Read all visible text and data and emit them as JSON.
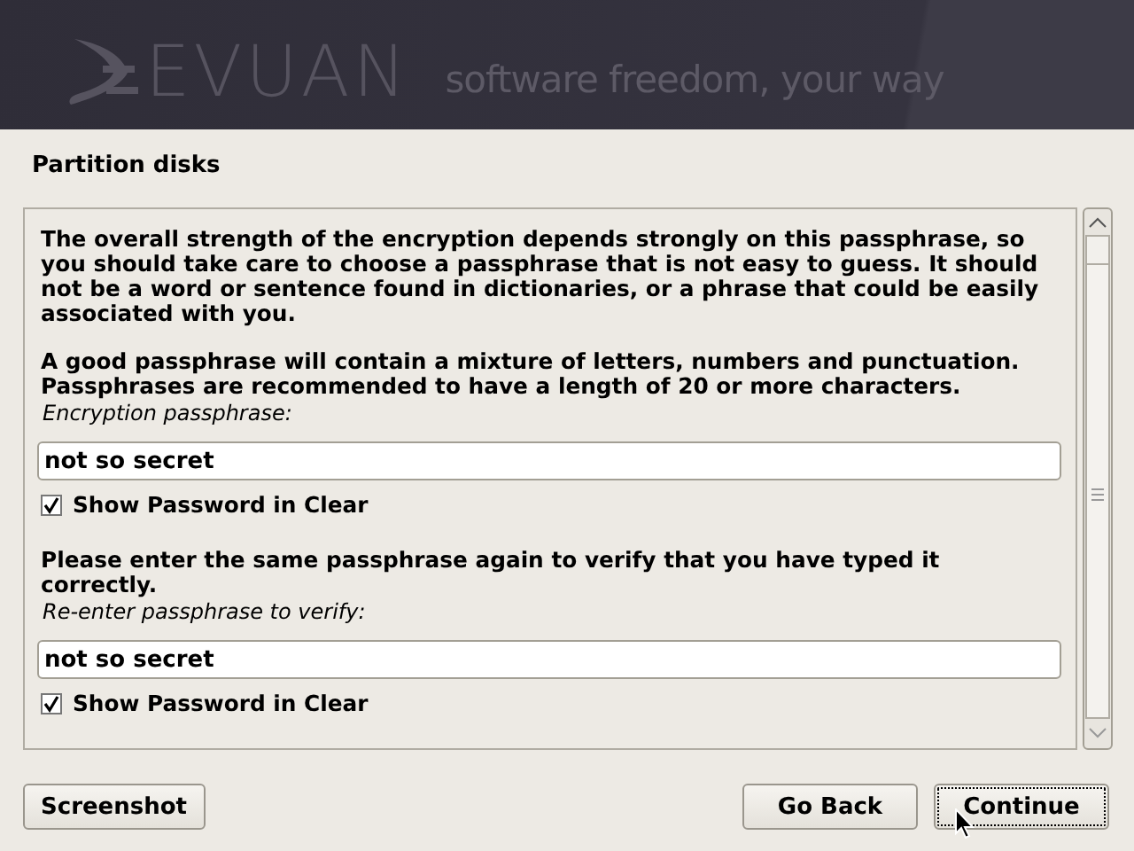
{
  "header": {
    "logo_text": "EVUAN",
    "tagline": "software freedom, your way"
  },
  "title": "Partition disks",
  "content": [
    {
      "kind": "paragraph",
      "text": "The overall strength of the encryption depends strongly on this passphrase, so you should take care to choose a passphrase that is not easy to guess. It should not be a word or sentence found in dictionaries, or a phrase that could be easily associated with you."
    },
    {
      "kind": "paragraph",
      "text": "A good passphrase will contain a mixture of letters, numbers and punctuation. Passphrases are recommended to have a length of 20 or more characters."
    },
    {
      "kind": "label",
      "text": "Encryption passphrase:"
    },
    {
      "kind": "field",
      "value": "not so secret"
    },
    {
      "kind": "checkbox",
      "text": "Show Password in Clear",
      "checked": true
    },
    {
      "kind": "paragraph",
      "text": "Please enter the same passphrase again to verify that you have typed it correctly."
    },
    {
      "kind": "label",
      "text": "Re-enter passphrase to verify:"
    },
    {
      "kind": "field",
      "value": "not so secret"
    },
    {
      "kind": "checkbox",
      "text": "Show Password in Clear",
      "checked": true
    }
  ],
  "buttons_left": [
    {
      "label": "Screenshot",
      "focused": false
    }
  ],
  "buttons_right": [
    {
      "label": "Go Back",
      "focused": false
    },
    {
      "label": "Continue",
      "focused": true
    }
  ]
}
